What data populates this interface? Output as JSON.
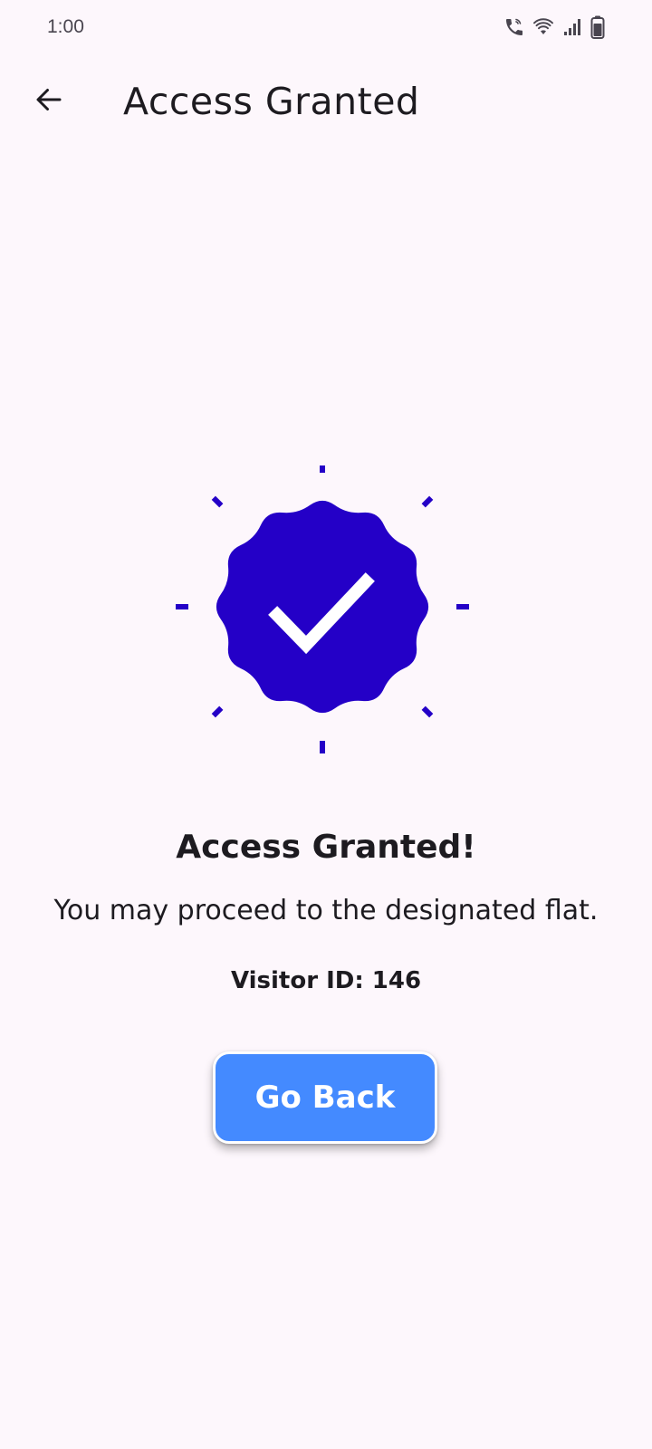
{
  "status_bar": {
    "time": "1:00",
    "icons": [
      "wifi-calling-icon",
      "wifi-icon",
      "signal-icon",
      "battery-icon"
    ]
  },
  "app_bar": {
    "title": "Access Granted",
    "back_icon": "arrow-back-icon"
  },
  "main": {
    "badge_icon": "verified-check-badge-icon",
    "headline": "Access Granted!",
    "message": "You may proceed to the designated flat.",
    "visitor_id": "Visitor ID: 146",
    "go_back_label": "Go Back"
  },
  "colors": {
    "background": "#fdf7fc",
    "badge": "#2400c7",
    "button": "#448aff",
    "text": "#1d1b20"
  }
}
